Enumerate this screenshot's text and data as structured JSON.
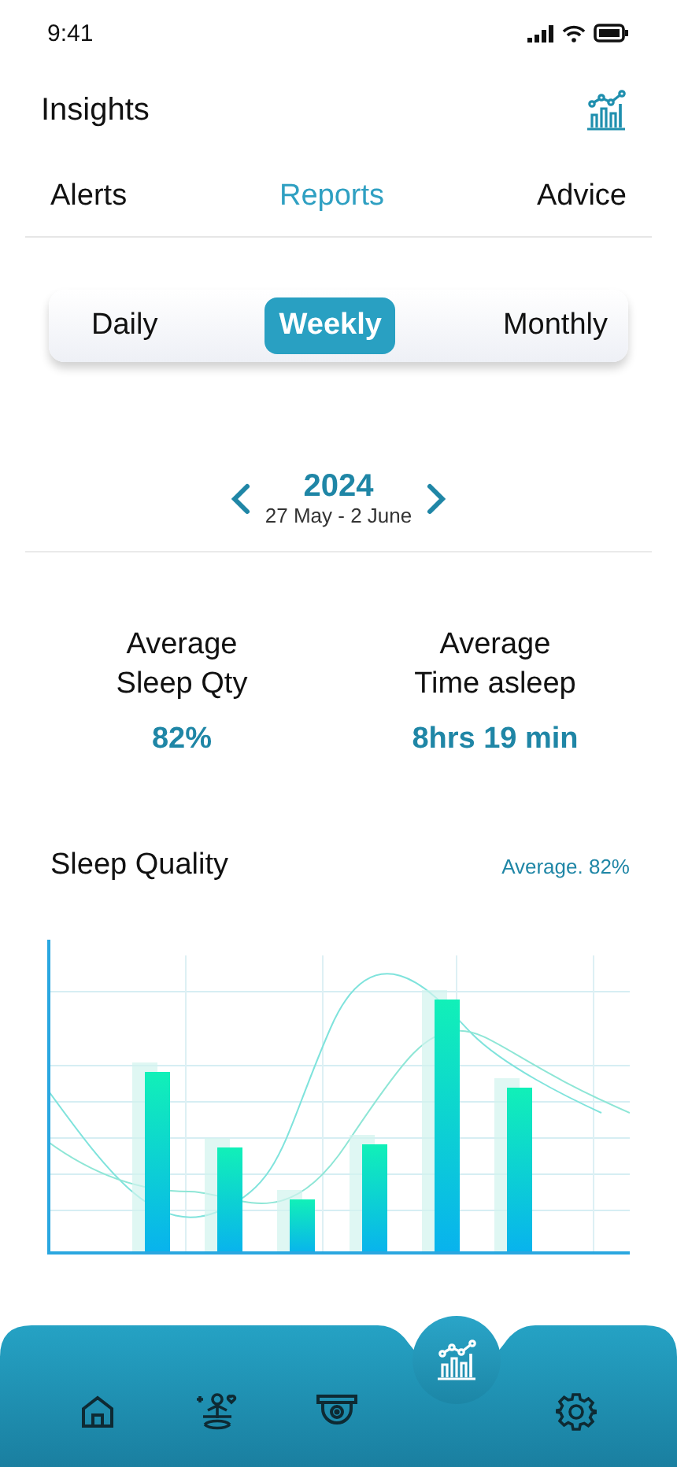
{
  "status_bar": {
    "time": "9:41"
  },
  "header": {
    "title": "Insights"
  },
  "tabs": [
    {
      "label": "Alerts",
      "selected": false
    },
    {
      "label": "Reports",
      "selected": true
    },
    {
      "label": "Advice",
      "selected": false
    }
  ],
  "period": [
    {
      "label": "Daily",
      "selected": false
    },
    {
      "label": "Weekly",
      "selected": true
    },
    {
      "label": "Monthly",
      "selected": false
    }
  ],
  "date_nav": {
    "year": "2024",
    "range": "27 May - 2 June"
  },
  "stats": [
    {
      "label": "Average\nSleep Qty",
      "value": "82%"
    },
    {
      "label": "Average\nTime asleep",
      "value": "8hrs 19 min"
    }
  ],
  "sleep_quality": {
    "title": "Sleep Quality",
    "average": "Average. 82%"
  },
  "nav": [
    {
      "kind": "home",
      "selected": false
    },
    {
      "kind": "meditation",
      "selected": false
    },
    {
      "kind": "camera",
      "selected": false
    },
    {
      "kind": "insights",
      "selected": true
    },
    {
      "kind": "settings",
      "selected": false
    }
  ]
}
